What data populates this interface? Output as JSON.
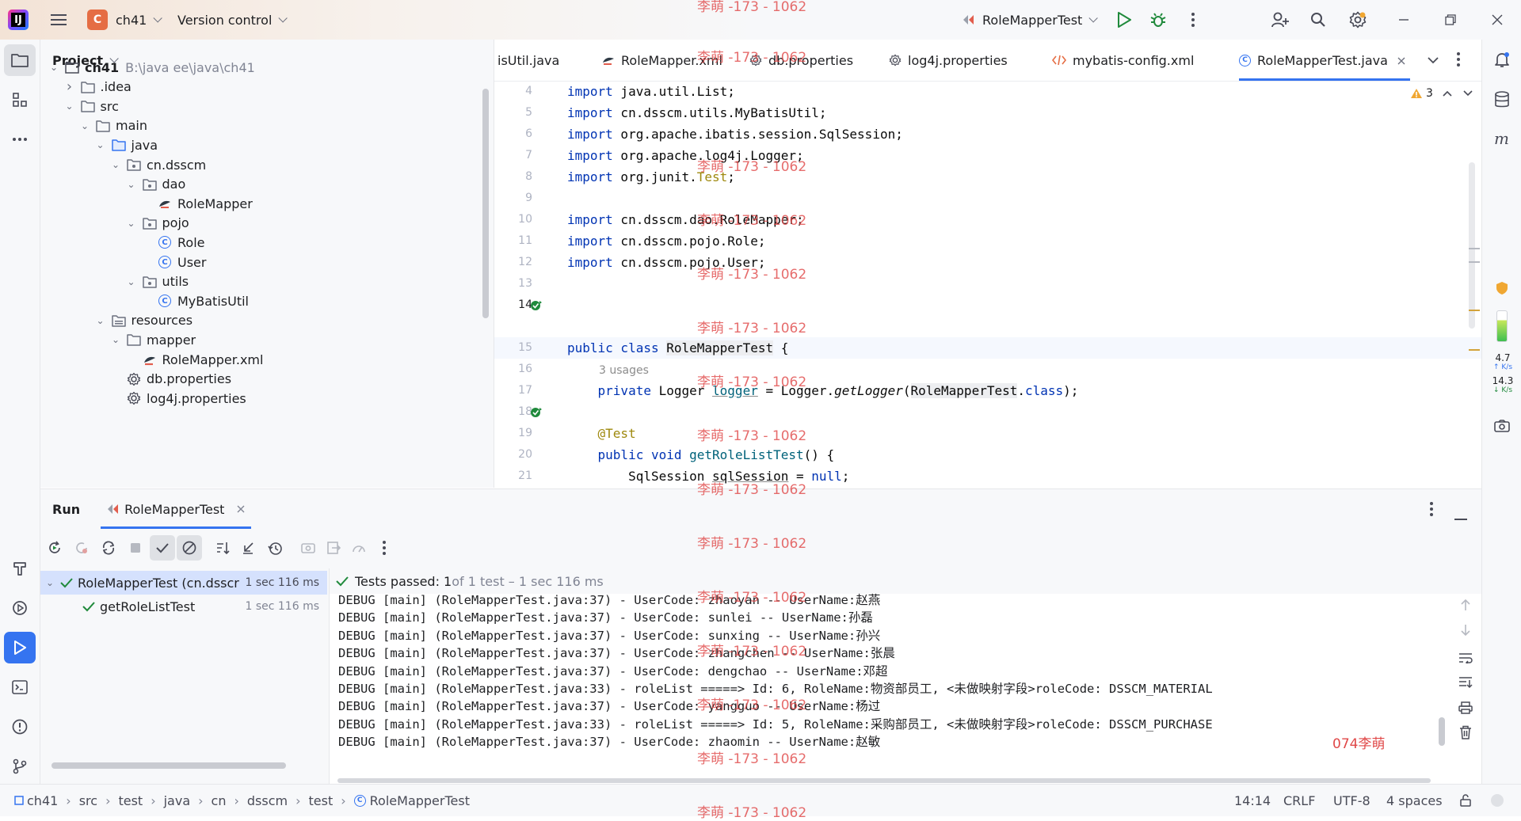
{
  "titlebar": {
    "project_badge": "C",
    "project_name": "ch41",
    "vcs_label": "Version control",
    "run_config": "RoleMapperTest"
  },
  "project_panel": {
    "title": "Project",
    "tree": [
      {
        "label": "ch41",
        "muted": "B:\\java ee\\java\\ch41",
        "depth": 0,
        "kind": "module",
        "expanded": true
      },
      {
        "label": ".idea",
        "depth": 1,
        "kind": "folder",
        "expanded": false
      },
      {
        "label": "src",
        "depth": 1,
        "kind": "folder",
        "expanded": true
      },
      {
        "label": "main",
        "depth": 2,
        "kind": "folder",
        "expanded": true
      },
      {
        "label": "java",
        "depth": 3,
        "kind": "src-folder",
        "expanded": true
      },
      {
        "label": "cn.dsscm",
        "depth": 4,
        "kind": "package",
        "expanded": true
      },
      {
        "label": "dao",
        "depth": 5,
        "kind": "package",
        "expanded": true
      },
      {
        "label": "RoleMapper",
        "depth": 6,
        "kind": "mapper"
      },
      {
        "label": "pojo",
        "depth": 5,
        "kind": "package",
        "expanded": true
      },
      {
        "label": "Role",
        "depth": 6,
        "kind": "class"
      },
      {
        "label": "User",
        "depth": 6,
        "kind": "class"
      },
      {
        "label": "utils",
        "depth": 5,
        "kind": "package",
        "expanded": true
      },
      {
        "label": "MyBatisUtil",
        "depth": 6,
        "kind": "class"
      },
      {
        "label": "resources",
        "depth": 3,
        "kind": "res-folder",
        "expanded": true
      },
      {
        "label": "mapper",
        "depth": 4,
        "kind": "folder",
        "expanded": true
      },
      {
        "label": "RoleMapper.xml",
        "depth": 5,
        "kind": "xml"
      },
      {
        "label": "db.properties",
        "depth": 4,
        "kind": "props"
      },
      {
        "label": "log4j.properties",
        "depth": 4,
        "kind": "props"
      }
    ]
  },
  "editor": {
    "tabs": [
      {
        "label": "isUtil.java",
        "kind": "java"
      },
      {
        "label": "RoleMapper.xml",
        "kind": "xml"
      },
      {
        "label": "db.properties",
        "kind": "props"
      },
      {
        "label": "log4j.properties",
        "kind": "props"
      },
      {
        "label": "mybatis-config.xml",
        "kind": "xmlcfg"
      },
      {
        "label": "RoleMapperTest.java",
        "kind": "class",
        "active": true
      }
    ],
    "warnings_count": "3",
    "usages_hint": "3 usages",
    "line_numbers": [
      "4",
      "5",
      "6",
      "7",
      "8",
      "9",
      "10",
      "11",
      "12",
      "13",
      "14",
      "15",
      "16",
      "17",
      "18",
      "19",
      "20",
      "21"
    ]
  },
  "run_panel": {
    "title": "Run",
    "tab_label": "RoleMapperTest",
    "tests": [
      {
        "label": "RoleMapperTest (cn.dsscr",
        "time": "1 sec 116 ms"
      },
      {
        "label": "getRoleListTest",
        "time": "1 sec 116 ms"
      }
    ],
    "status_passed": "Tests passed: 1",
    "status_rest": " of 1 test – 1 sec 116 ms",
    "console_lines": [
      "DEBUG [main] (RoleMapperTest.java:37) - UserCode: zhaoyan -- UserName:赵燕",
      "DEBUG [main] (RoleMapperTest.java:37) - UserCode: sunlei -- UserName:孙磊",
      "DEBUG [main] (RoleMapperTest.java:37) - UserCode: sunxing -- UserName:孙兴",
      "DEBUG [main] (RoleMapperTest.java:37) - UserCode: zhangchen -- UserName:张晨",
      "DEBUG [main] (RoleMapperTest.java:37) - UserCode: dengchao -- UserName:邓超",
      "DEBUG [main] (RoleMapperTest.java:33) - roleList =====> Id: 6, RoleName:物资部员工, <未做映射字段>roleCode: DSSCM_MATERIAL",
      "DEBUG [main] (RoleMapperTest.java:37) - UserCode: yangguo -- UserName:杨过",
      "DEBUG [main] (RoleMapperTest.java:33) - roleList =====> Id: 5, RoleName:采购部员工, <未做映射字段>roleCode: DSSCM_PURCHASE",
      "DEBUG [main] (RoleMapperTest.java:37) - UserCode: zhaomin -- UserName:赵敏"
    ],
    "console_watermark": "074李萌"
  },
  "statusbar": {
    "breadcrumbs": [
      "ch41",
      "src",
      "test",
      "java",
      "cn",
      "dsscm",
      "test",
      "RoleMapperTest"
    ],
    "position": "14:14",
    "line_sep": "CRLF",
    "encoding": "UTF-8",
    "indent": "4 spaces"
  },
  "right_strip": {
    "up_speed": "4.7",
    "down_speed": "14.3",
    "speed_unit": "K/s"
  },
  "watermark": {
    "text": "李萌 -173 - 1062"
  },
  "colors": {
    "accent": "#3574f0",
    "pass_green": "#208a3c",
    "keyword": "#0033b3",
    "annotation": "#9e880d"
  }
}
